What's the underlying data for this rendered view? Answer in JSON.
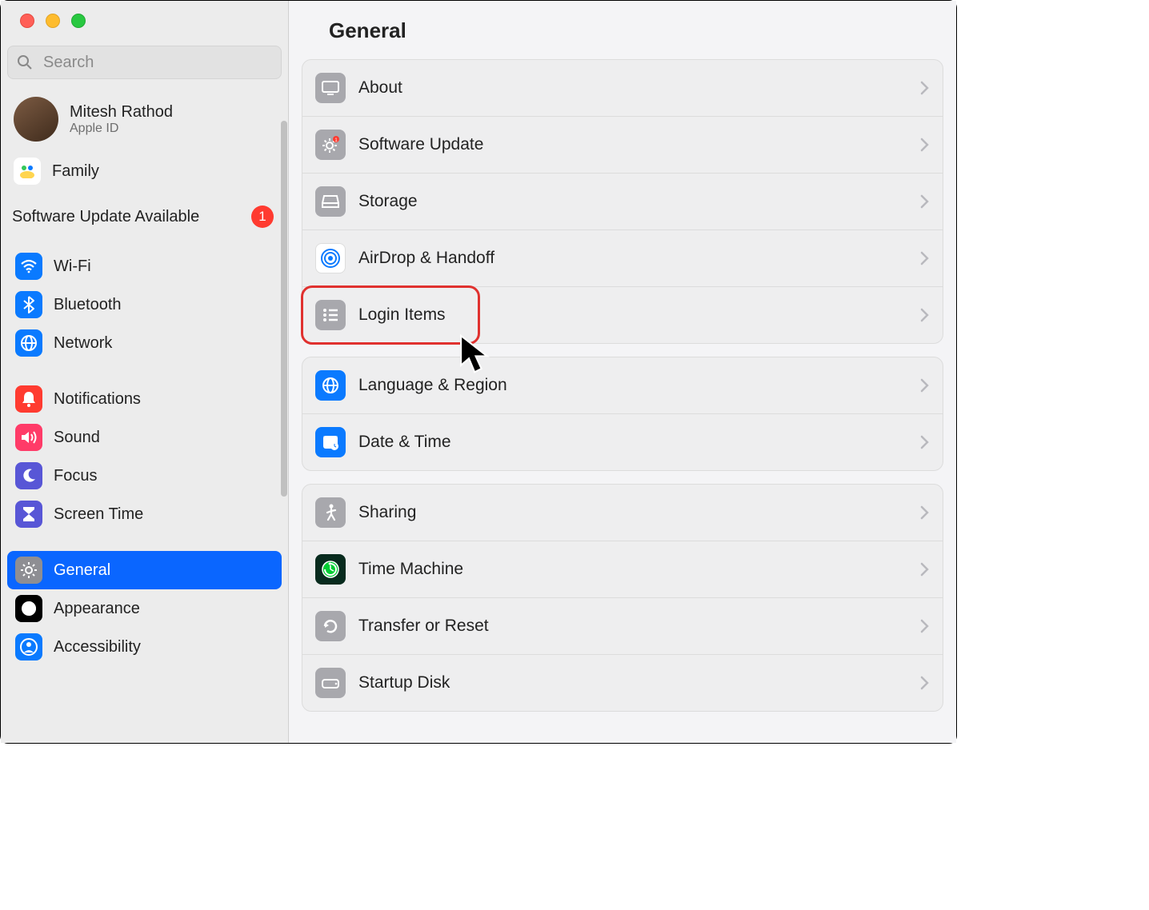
{
  "search": {
    "placeholder": "Search"
  },
  "account": {
    "name": "Mitesh Rathod",
    "sub": "Apple ID"
  },
  "family": {
    "label": "Family"
  },
  "update": {
    "text": "Software Update Available",
    "badge": "1"
  },
  "sidebar": {
    "items": [
      {
        "label": "Wi-Fi",
        "icon": "wifi",
        "color": "#0a7aff"
      },
      {
        "label": "Bluetooth",
        "icon": "bluetooth",
        "color": "#0a7aff"
      },
      {
        "label": "Network",
        "icon": "globe",
        "color": "#0a7aff"
      },
      {
        "label": "Notifications",
        "icon": "bell",
        "color": "#ff3b30"
      },
      {
        "label": "Sound",
        "icon": "speaker",
        "color": "#ff3b68"
      },
      {
        "label": "Focus",
        "icon": "moon",
        "color": "#5856d6"
      },
      {
        "label": "Screen Time",
        "icon": "hourglass",
        "color": "#5856d6"
      },
      {
        "label": "General",
        "icon": "gear",
        "color": "#8e8e93",
        "selected": true
      },
      {
        "label": "Appearance",
        "icon": "contrast",
        "color": "#000000"
      },
      {
        "label": "Accessibility",
        "icon": "person",
        "color": "#0a7aff"
      }
    ]
  },
  "main": {
    "title": "General"
  },
  "groups": [
    {
      "rows": [
        {
          "label": "About",
          "icon": "display",
          "color": "#a8a8ad"
        },
        {
          "label": "Software Update",
          "icon": "gear-badge",
          "color": "#a8a8ad"
        },
        {
          "label": "Storage",
          "icon": "drive",
          "color": "#a8a8ad"
        },
        {
          "label": "AirDrop & Handoff",
          "icon": "airdrop",
          "color": "#ffffff"
        },
        {
          "label": "Login Items",
          "icon": "list",
          "color": "#a8a8ad",
          "highlighted": true
        }
      ]
    },
    {
      "rows": [
        {
          "label": "Language & Region",
          "icon": "globe",
          "color": "#0a7aff"
        },
        {
          "label": "Date & Time",
          "icon": "calendar-clock",
          "color": "#0a7aff"
        }
      ]
    },
    {
      "rows": [
        {
          "label": "Sharing",
          "icon": "walking",
          "color": "#a8a8ad"
        },
        {
          "label": "Time Machine",
          "icon": "clock-arrow",
          "color": "#0a3e2a"
        },
        {
          "label": "Transfer or Reset",
          "icon": "rotate",
          "color": "#a8a8ad"
        },
        {
          "label": "Startup Disk",
          "icon": "drive2",
          "color": "#a8a8ad"
        }
      ]
    }
  ]
}
